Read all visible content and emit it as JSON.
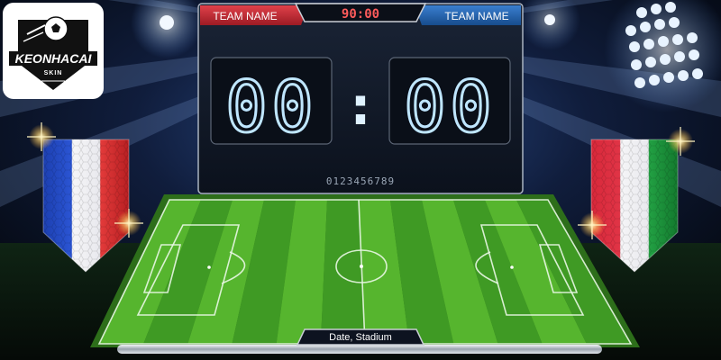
{
  "scoreboard": {
    "home_team_label": "TEAM NAME",
    "away_team_label": "TEAM NAME",
    "match_time": "90:00",
    "home_score": "00",
    "score_separator": ":",
    "away_score": "00",
    "digit_sample": "0123456789"
  },
  "venue": {
    "label": "Date, Stadium"
  },
  "logo": {
    "brand": "KEONHACAI",
    "sub": "SKIN"
  },
  "colors": {
    "home_accent": "#c62832",
    "away_accent": "#1f5fa8",
    "digit_glow": "#bfe6ff",
    "pitch_dark": "#3f9a24",
    "pitch_light": "#56b52e"
  },
  "flags": {
    "left": "france-flag-pennant",
    "right": "italy-flag-pennant"
  }
}
